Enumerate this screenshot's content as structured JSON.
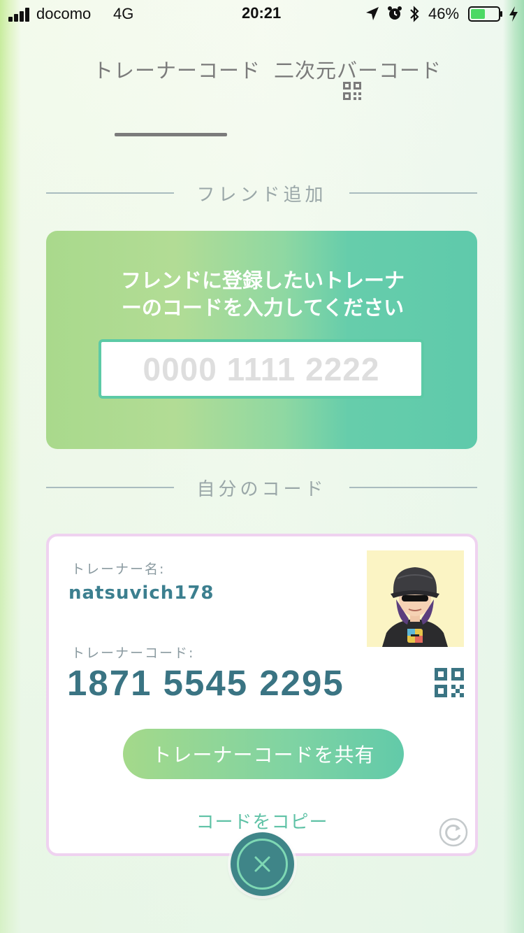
{
  "status_bar": {
    "carrier": "docomo",
    "network": "4G",
    "time": "20:21",
    "battery_percent": "46%",
    "icons": [
      "signal-icon",
      "location-arrow-icon",
      "alarm-icon",
      "bluetooth-icon",
      "battery-icon",
      "charging-icon"
    ]
  },
  "tabs": [
    {
      "label": "トレーナーコード",
      "selected": true
    },
    {
      "label": "二次元バーコード",
      "selected": false,
      "icon": "qr-code-icon"
    }
  ],
  "add_friend": {
    "header": "フレンド追加",
    "prompt_line1": "フレンドに登録したいトレーナ",
    "prompt_line2": "ーのコードを入力してください",
    "input_value": "",
    "input_placeholder": "0000 1111 2222"
  },
  "my_code": {
    "header": "自分のコード",
    "trainer_name_label": "トレーナー名:",
    "trainer_name": "natsuvich178",
    "trainer_code_label": "トレーナーコード:",
    "trainer_code": "1871 5545 2295",
    "share_button": "トレーナーコードを共有",
    "copy_link": "コードをコピー",
    "avatar_icon": "trainer-avatar",
    "qr_icon": "qr-code-icon",
    "refresh_icon": "refresh-icon"
  },
  "close_icon": "close-icon",
  "colors": {
    "accent_green": "#5fcaab",
    "code_text": "#3a7483",
    "card_border": "#efd2f0",
    "close_button": "#3f8588"
  }
}
